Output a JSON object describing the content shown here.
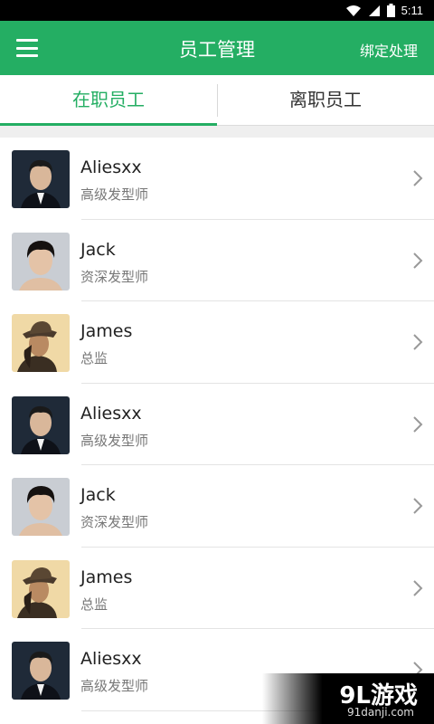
{
  "status_bar": {
    "time": "5:11",
    "icons": [
      "wifi-icon",
      "signal-icon",
      "battery-icon"
    ]
  },
  "app_bar": {
    "title": "员工管理",
    "action_label": "绑定处理",
    "menu_icon": "menu-icon"
  },
  "tabs": [
    {
      "label": "在职员工",
      "active": true
    },
    {
      "label": "离职员工",
      "active": false
    }
  ],
  "employees": [
    {
      "name": "Aliesxx",
      "role": "高级发型师",
      "avatar": "avatar-man-suit"
    },
    {
      "name": "Jack",
      "role": "资深发型师",
      "avatar": "avatar-man-shirtless"
    },
    {
      "name": "James",
      "role": "总监",
      "avatar": "avatar-man-hat"
    },
    {
      "name": "Aliesxx",
      "role": "高级发型师",
      "avatar": "avatar-man-suit"
    },
    {
      "name": "Jack",
      "role": "资深发型师",
      "avatar": "avatar-man-shirtless"
    },
    {
      "name": "James",
      "role": "总监",
      "avatar": "avatar-man-hat"
    },
    {
      "name": "Aliesxx",
      "role": "高级发型师",
      "avatar": "avatar-man-suit"
    }
  ],
  "watermark": {
    "logo": "9L游戏",
    "url": "91danji.com"
  },
  "colors": {
    "accent": "#24ae63",
    "status_bar": "#000000"
  }
}
